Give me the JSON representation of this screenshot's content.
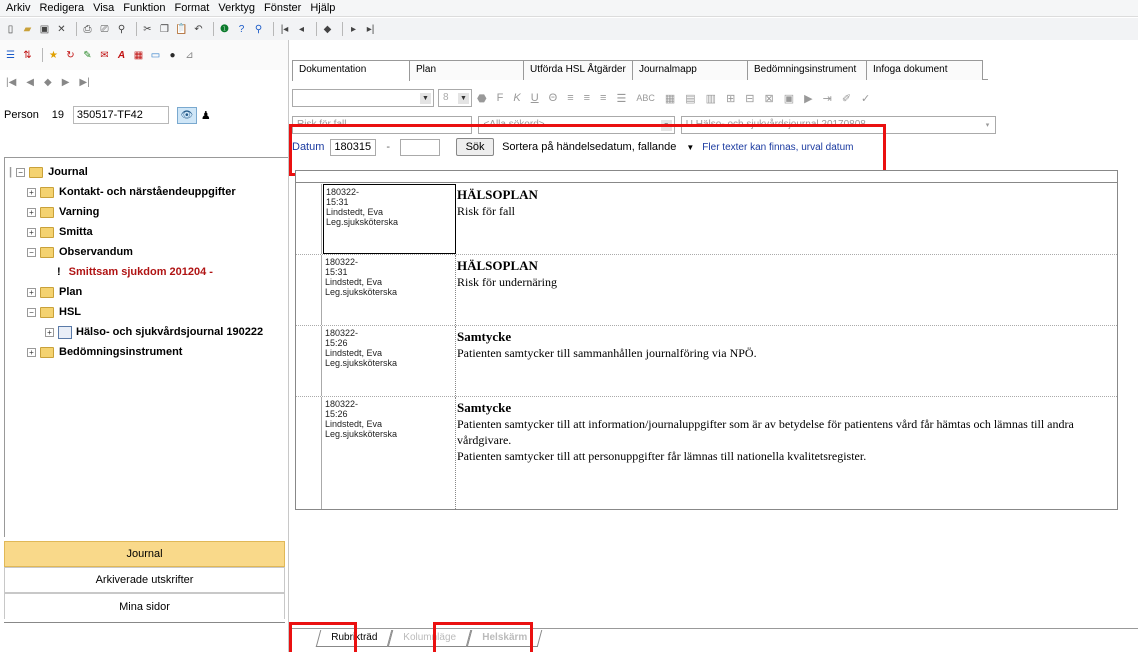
{
  "menu": [
    "Arkiv",
    "Redigera",
    "Visa",
    "Funktion",
    "Format",
    "Verktyg",
    "Fönster",
    "Hjälp"
  ],
  "toolbar_icons": [
    "new-doc-icon",
    "open-folder-icon",
    "save-icon",
    "delete-icon",
    "print-icon",
    "print-preview-icon",
    "find-icon",
    "cut-icon",
    "copy-icon",
    "paste-icon",
    "undo-icon",
    "info-icon",
    "help-icon",
    "search-icon",
    "first-icon",
    "prev-icon",
    "bookmark-icon",
    "next-icon",
    "last-icon"
  ],
  "left_nav": [
    "|◀",
    "◀",
    "◆",
    "▶",
    "▶|"
  ],
  "person": {
    "label": "Person",
    "century": "19",
    "number": "350517-TF42"
  },
  "tree": {
    "root": "Journal",
    "items": [
      {
        "label": "Kontakt- och närståendeuppgifter",
        "expander": "+",
        "level": 1
      },
      {
        "label": "Varning",
        "expander": "+",
        "level": 1
      },
      {
        "label": "Smitta",
        "expander": "+",
        "level": 1
      },
      {
        "label": "Observandum",
        "expander": "−",
        "level": 1
      },
      {
        "label": "Smittsam sjukdom 201204 -",
        "expander": "!",
        "level": 2,
        "warning": true
      },
      {
        "label": "Plan",
        "expander": "+",
        "level": 1
      },
      {
        "label": "HSL",
        "expander": "−",
        "level": 1
      },
      {
        "label": "Hälso- och sjukvårdsjournal 190222",
        "expander": "+",
        "level": 2
      },
      {
        "label": "Bedömningsinstrument",
        "expander": "+",
        "level": 1
      }
    ]
  },
  "left_buttons": {
    "journal": "Journal",
    "archived": "Arkiverade utskrifter",
    "my_pages": "Mina sidor"
  },
  "tabs": [
    "Dokumentation",
    "Plan",
    "Utförda HSL Åtgärder",
    "Journalmapp",
    "Bedömningsinstrument",
    "Infoga dokument"
  ],
  "format": {
    "font_size": "8",
    "icons": [
      "F",
      "K",
      "U",
      "Θ",
      "≡",
      "≡",
      "≡",
      "☰",
      "ABC"
    ]
  },
  "filter": {
    "keyword": "Risk för fall",
    "search_word": "<Alla sökord>",
    "journal": "U Hälso- och sjukvårdsjournal 20170808"
  },
  "datum": {
    "label": "Datum",
    "from": "180315",
    "dash": "-",
    "to": ""
  },
  "search_button": "Sök",
  "sort": "Sortera på händelsedatum, fallande",
  "info_text": "Fler texter kan finnas, urval datum",
  "entries": [
    {
      "date": "180322-",
      "time": "15:31",
      "author": "Lindstedt, Eva",
      "role": "Leg.sjuksköterska",
      "heading": "HÄLSOPLAN",
      "lines": [
        "Risk för fall"
      ]
    },
    {
      "date": "180322-",
      "time": "15:31",
      "author": "Lindstedt, Eva",
      "role": "Leg.sjuksköterska",
      "heading": "HÄLSOPLAN",
      "lines": [
        "Risk för undernäring"
      ]
    },
    {
      "date": "180322-",
      "time": "15:26",
      "author": "Lindstedt, Eva",
      "role": "Leg.sjuksköterska",
      "heading": "Samtycke",
      "lines": [
        "Patienten samtycker till sammanhållen journalföring via NPÖ."
      ]
    },
    {
      "date": "180322-",
      "time": "15:26",
      "author": "Lindstedt, Eva",
      "role": "Leg.sjuksköterska",
      "heading": "Samtycke",
      "lines": [
        "Patienten samtycker till att information/journaluppgifter som är av betydelse för patientens vård får hämtas och lämnas till andra vårdgivare.",
        "Patienten samtycker till att personuppgifter får lämnas till nationella kvalitetsregister."
      ]
    }
  ],
  "bottom_tabs": [
    "Rubrikträd",
    "Kolumnläge",
    "Helskärm"
  ],
  "colors": {
    "highlight": "#ea1010",
    "active_button": "#f9d98a",
    "warning_text": "#b01414",
    "link_blue": "#1a3aa0",
    "folder": "#f4d270"
  }
}
